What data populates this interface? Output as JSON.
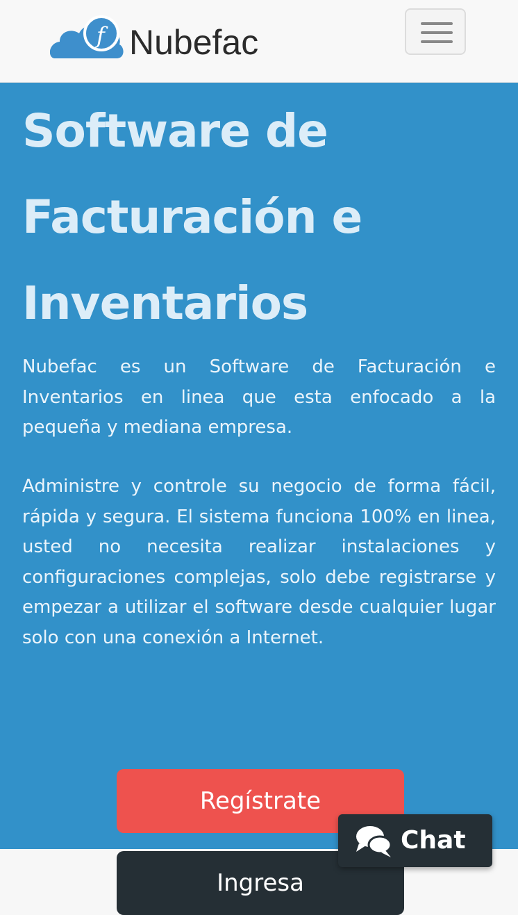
{
  "brand": {
    "name": "Nubefac"
  },
  "nav": {
    "menu_icon": "hamburger-menu-icon"
  },
  "hero": {
    "title": "Software de Facturación e Inventarios",
    "paragraph1": "Nubefac es un Software de Facturación e Inventarios en linea que esta enfocado a la pequeña y mediana empresa.",
    "paragraph2": "Administre y controle su negocio de forma fácil, rápida y segura. El sistema funciona 100% en linea, usted no necesita realizar instalaciones y configuraciones complejas, solo debe registrarse y empezar a utilizar el software desde cualquier lugar solo con una conexión a Internet.",
    "register_label": "Regístrate",
    "login_label": "Ingresa"
  },
  "chat": {
    "label": "Chat",
    "icon": "chat-bubbles-icon"
  },
  "colors": {
    "hero_bg": "#3291c9",
    "register": "#ee524e",
    "dark": "#252f35",
    "logo_blue": "#3e8fcc"
  }
}
